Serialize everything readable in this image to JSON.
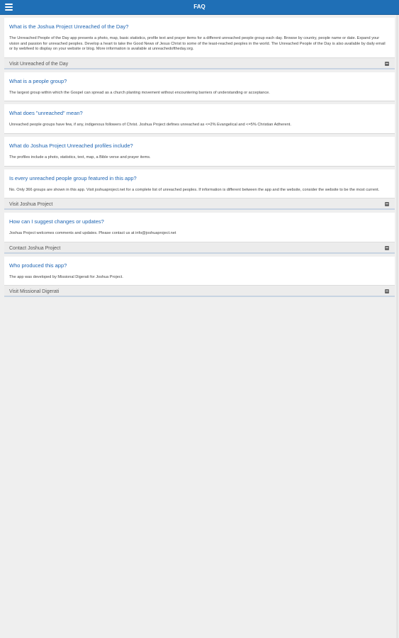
{
  "header": {
    "title": "FAQ",
    "menu_icon": "hamburger-menu-icon",
    "color": "#1f6fb6"
  },
  "faq": [
    {
      "question": "What is the Joshua Project Unreached of the Day?",
      "answer": "The Unreached People of the Day app presents a photo, map, basic statistics, profile text and prayer items for a different unreached people group each day. Browse by country, people name or date. Expand your vision and passion for unreached peoples. Develop a heart to take the Good News of Jesus Christ to some of the least-reached peoples in the world. The Unreached People of the Day is also available by daily email or by webfeed to display on your website or blog. More information is available at unreachedoftheday.org.",
      "link": "Visit Unreached of the Day"
    },
    {
      "question": "What is a people group?",
      "answer": "The largest group within which the Gospel can spread as a church planting movement without encountering barriers of understanding or acceptance."
    },
    {
      "question": "What does \"unreached\" mean?",
      "answer": "Unreached people groups have few, if any, indigenous followers of Christ. Joshua Project defines unreached as <=2% Evangelical and <=5% Christian Adherent."
    },
    {
      "question": "What do Joshua Project Unreached profiles include?",
      "answer": "The profiles include a photo, statistics, text, map, a Bible verse and prayer items."
    },
    {
      "question": "Is every unreached people group featured in this app?",
      "answer": "No. Only 366 groups are shown in this app. Visit joshuaproject.net for a complete list of unreached peoples. If information is different between the app and the website, consider the website to be the most current.",
      "link": "Visit Joshua Project"
    },
    {
      "question": "How can I suggest changes or updates?",
      "answer": "Joshua Project welcomes comments and updates. Please contact us at info@joshuaproject.net",
      "link": "Contact Joshua Project"
    },
    {
      "question": "Who produced this app?",
      "answer": "The app was developed by Missional Digerati for Joshua Project.",
      "link": "Visit Missional Digerati"
    }
  ],
  "icons": {
    "link": "external-link-icon"
  }
}
